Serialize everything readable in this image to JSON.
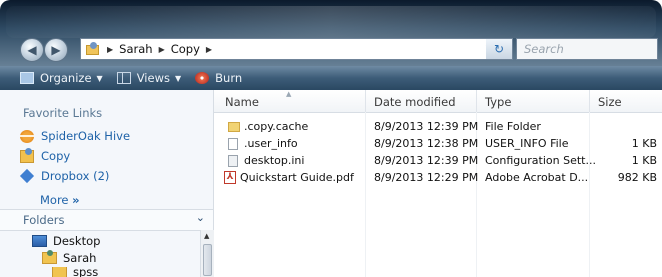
{
  "address": {
    "crumbs": [
      "Sarah",
      "Copy"
    ]
  },
  "search": {
    "placeholder": "Search"
  },
  "toolbar": {
    "organize": "Organize",
    "views": "Views",
    "burn": "Burn"
  },
  "nav": {
    "favorites_heading": "Favorite Links",
    "links": [
      {
        "label": "SpiderOak Hive",
        "icon": "spideroak-icon"
      },
      {
        "label": "Copy",
        "icon": "folder-icon"
      },
      {
        "label": "Dropbox (2)",
        "icon": "dropbox-icon"
      }
    ],
    "more": "More",
    "more_glyph": "»",
    "folders_label": "Folders",
    "tree": [
      {
        "label": "Desktop"
      },
      {
        "label": "Sarah"
      },
      {
        "label": "spss"
      }
    ]
  },
  "columns": {
    "name": "Name",
    "date": "Date modified",
    "type": "Type",
    "size": "Size"
  },
  "files": [
    {
      "name": ".copy.cache",
      "date": "8/9/2013 12:39 PM",
      "type": "File Folder",
      "size": "",
      "icon": "folder-icon"
    },
    {
      "name": ".user_info",
      "date": "8/9/2013 12:38 PM",
      "type": "USER_INFO File",
      "size": "1 KB",
      "icon": "file-icon"
    },
    {
      "name": "desktop.ini",
      "date": "8/9/2013 12:39 PM",
      "type": "Configuration Sett...",
      "size": "1 KB",
      "icon": "settings-file-icon"
    },
    {
      "name": "Quickstart Guide.pdf",
      "date": "8/9/2013 12:29 PM",
      "type": "Adobe Acrobat D...",
      "size": "982 KB",
      "icon": "pdf-icon"
    }
  ]
}
